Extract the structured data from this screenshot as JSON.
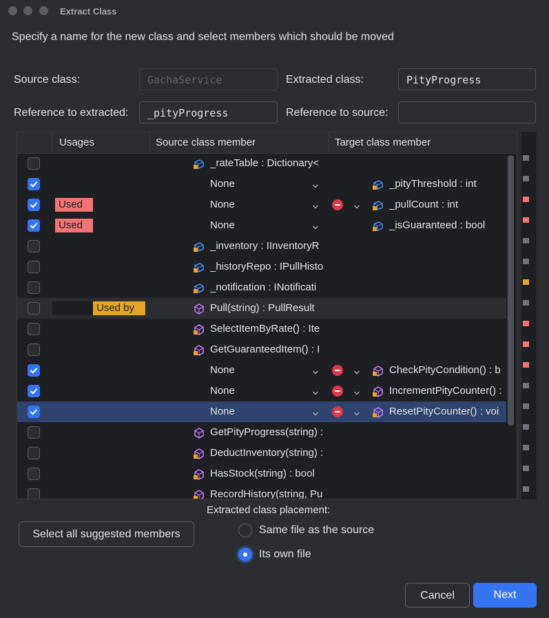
{
  "window": {
    "title": "Extract Class"
  },
  "intro": "Specify a name for the new class and select members which should be moved",
  "form": {
    "source_class_label": "Source class:",
    "source_class_value": "GachaService",
    "extracted_class_label": "Extracted class:",
    "extracted_class_value": "PityProgress",
    "ref_extracted_label": "Reference to extracted:",
    "ref_extracted_value": "_pityProgress",
    "ref_source_label": "Reference to source:",
    "ref_source_value": ""
  },
  "table": {
    "headers": {
      "usages": "Usages",
      "source": "Source class member",
      "target": "Target class member"
    },
    "rows": [
      {
        "checked": false,
        "badge": "",
        "member": "_rateTable : Dictionary<",
        "kind": "field",
        "target": "",
        "none": false
      },
      {
        "checked": true,
        "badge": "",
        "member": "",
        "kind": "",
        "none": true,
        "minus": false,
        "target": "_pityThreshold : int",
        "target_kind": "field"
      },
      {
        "checked": true,
        "badge": "Used",
        "member": "",
        "kind": "",
        "none": true,
        "minus": true,
        "target": "_pullCount : int",
        "target_kind": "field"
      },
      {
        "checked": true,
        "badge": "Used",
        "member": "",
        "kind": "",
        "none": true,
        "minus": false,
        "target": "_isGuaranteed : bool",
        "target_kind": "field"
      },
      {
        "checked": false,
        "badge": "",
        "member": "_inventory : IInventoryR",
        "kind": "field",
        "target": "",
        "none": false
      },
      {
        "checked": false,
        "badge": "",
        "member": "_historyRepo : IPullHisto",
        "kind": "field",
        "target": "",
        "none": false
      },
      {
        "checked": false,
        "badge": "",
        "member": "_notification : INotificati",
        "kind": "field",
        "target": "",
        "none": false
      },
      {
        "checked": false,
        "badge": "Used by",
        "member": "Pull(string) : PullResult",
        "kind": "method-public",
        "target": "",
        "none": false,
        "highlight": true
      },
      {
        "checked": false,
        "badge": "",
        "member": "SelectItemByRate() : Ite",
        "kind": "method",
        "target": "",
        "none": false
      },
      {
        "checked": false,
        "badge": "",
        "member": "GetGuaranteedItem() : I",
        "kind": "method",
        "target": "",
        "none": false
      },
      {
        "checked": true,
        "badge": "",
        "member": "",
        "kind": "",
        "none": true,
        "minus": true,
        "target": "CheckPityCondition() : b",
        "target_kind": "method"
      },
      {
        "checked": true,
        "badge": "",
        "member": "",
        "kind": "",
        "none": true,
        "minus": true,
        "target": "IncrementPityCounter() :",
        "target_kind": "method"
      },
      {
        "checked": true,
        "badge": "",
        "member": "",
        "kind": "",
        "none": true,
        "minus": true,
        "target": "ResetPityCounter() : voi",
        "target_kind": "method",
        "selected": true
      },
      {
        "checked": false,
        "badge": "",
        "member": "GetPityProgress(string) :",
        "kind": "method-public",
        "target": "",
        "none": false
      },
      {
        "checked": false,
        "badge": "",
        "member": "DeductInventory(string) :",
        "kind": "method",
        "target": "",
        "none": false
      },
      {
        "checked": false,
        "badge": "",
        "member": "HasStock(string) : bool",
        "kind": "method",
        "target": "",
        "none": false
      },
      {
        "checked": false,
        "badge": "",
        "member": "RecordHistory(string, Pu",
        "kind": "method",
        "target": "",
        "none": false
      }
    ],
    "none_label": "None"
  },
  "stripe_marks": [
    {
      "color": "#6f737a"
    },
    {
      "color": "#6f737a"
    },
    {
      "color": "#f27474"
    },
    {
      "color": "#f27474"
    },
    {
      "color": "#6f737a"
    },
    {
      "color": "#6f737a"
    },
    {
      "color": "#e6a52a"
    },
    {
      "color": "#6f737a"
    },
    {
      "color": "#f27474"
    },
    {
      "color": "#f27474"
    },
    {
      "color": "#f27474"
    },
    {
      "color": "#6f737a"
    },
    {
      "color": "#6f737a"
    },
    {
      "color": "#6f737a"
    },
    {
      "color": "#6f737a"
    },
    {
      "color": "#6f737a"
    },
    {
      "color": "#6f737a"
    }
  ],
  "placement": {
    "label": "Extracted class placement:",
    "option_same": "Same file as the source",
    "option_own": "Its own file",
    "selected": "own"
  },
  "buttons": {
    "select_suggested": "Select all suggested members",
    "cancel": "Cancel",
    "next": "Next"
  },
  "colors": {
    "accent": "#3574f0",
    "used": "#f27474",
    "used_by": "#e6a52a",
    "selected_row": "#2e436e"
  }
}
